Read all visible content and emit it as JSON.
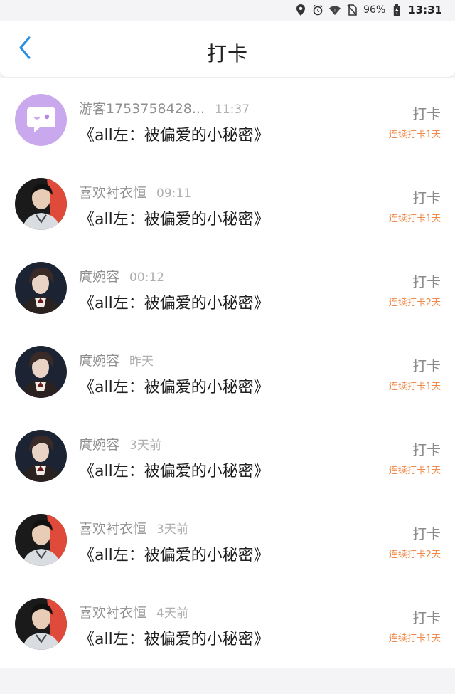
{
  "status_bar": {
    "battery": "96%",
    "time": "13:31"
  },
  "header": {
    "title": "打卡"
  },
  "list": [
    {
      "name": "游客1753758428...",
      "time": "11:37",
      "book": "《all左：被偏爱的小秘密》",
      "checkin": "打卡",
      "streak": "连续打卡1天",
      "avatar": "guest"
    },
    {
      "name": "喜欢衬衣恒",
      "time": "09:11",
      "book": "《all左：被偏爱的小秘密》",
      "checkin": "打卡",
      "streak": "连续打卡1天",
      "avatar": "red"
    },
    {
      "name": "庹婉容",
      "time": "00:12",
      "book": "《all左：被偏爱的小秘密》",
      "checkin": "打卡",
      "streak": "连续打卡2天",
      "avatar": "dark"
    },
    {
      "name": "庹婉容",
      "time": "昨天",
      "book": "《all左：被偏爱的小秘密》",
      "checkin": "打卡",
      "streak": "连续打卡1天",
      "avatar": "dark"
    },
    {
      "name": "庹婉容",
      "time": "3天前",
      "book": "《all左：被偏爱的小秘密》",
      "checkin": "打卡",
      "streak": "连续打卡1天",
      "avatar": "dark"
    },
    {
      "name": "喜欢衬衣恒",
      "time": "3天前",
      "book": "《all左：被偏爱的小秘密》",
      "checkin": "打卡",
      "streak": "连续打卡2天",
      "avatar": "red"
    },
    {
      "name": "喜欢衬衣恒",
      "time": "4天前",
      "book": "《all左：被偏爱的小秘密》",
      "checkin": "打卡",
      "streak": "连续打卡1天",
      "avatar": "red"
    }
  ],
  "colors": {
    "accent": "#2b8fe0",
    "streak": "#f08a4b",
    "guest_avatar": "#c9a8ee"
  }
}
